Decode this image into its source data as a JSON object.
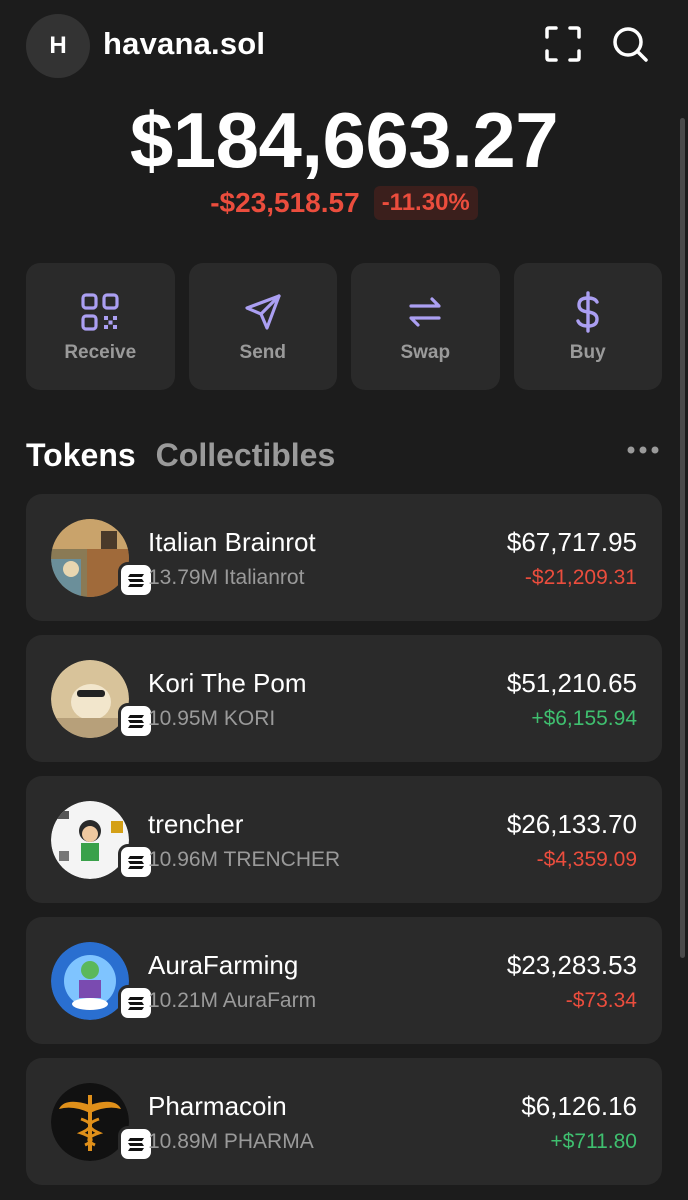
{
  "header": {
    "avatar_letter": "H",
    "account_name": "havana.sol"
  },
  "portfolio": {
    "balance": "$184,663.27",
    "change_amount": "-$23,518.57",
    "change_percent": "-11.30%"
  },
  "actions": [
    {
      "label": "Receive",
      "icon": "qr-code-icon"
    },
    {
      "label": "Send",
      "icon": "send-arrow-icon"
    },
    {
      "label": "Swap",
      "icon": "swap-arrows-icon"
    },
    {
      "label": "Buy",
      "icon": "dollar-icon"
    }
  ],
  "tabs": {
    "tokens": "Tokens",
    "collectibles": "Collectibles"
  },
  "tokens": [
    {
      "name": "Italian Brainrot",
      "amount": "13.79M Italianrot",
      "value": "$67,717.95",
      "change": "-$21,209.31",
      "direction": "neg"
    },
    {
      "name": "Kori The Pom",
      "amount": "10.95M KORI",
      "value": "$51,210.65",
      "change": "+$6,155.94",
      "direction": "pos"
    },
    {
      "name": "trencher",
      "amount": "10.96M TRENCHER",
      "value": "$26,133.70",
      "change": "-$4,359.09",
      "direction": "neg"
    },
    {
      "name": "AuraFarming",
      "amount": "10.21M AuraFarm",
      "value": "$23,283.53",
      "change": "-$73.34",
      "direction": "neg"
    },
    {
      "name": "Pharmacoin",
      "amount": "10.89M PHARMA",
      "value": "$6,126.16",
      "change": "+$711.80",
      "direction": "pos"
    }
  ],
  "colors": {
    "background": "#1c1c1c",
    "card": "#2a2a2a",
    "accent": "#ab9ff2",
    "negative": "#eb4d3d",
    "positive": "#3fbf6f",
    "muted": "#9a9a9a"
  }
}
